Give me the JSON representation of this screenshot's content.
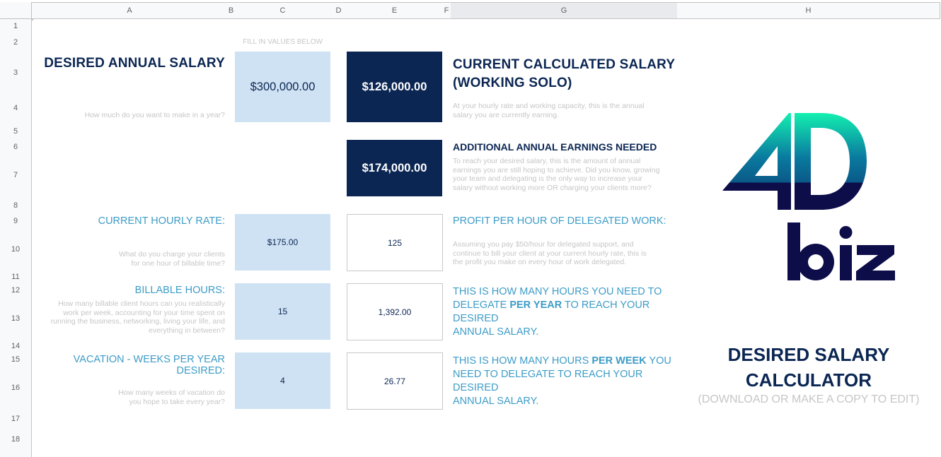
{
  "sheet": {
    "columns": [
      "A",
      "B",
      "C",
      "D",
      "E",
      "F",
      "G",
      "H"
    ],
    "selected_column": "G",
    "rows": [
      "1",
      "2",
      "3",
      "4",
      "5",
      "6",
      "7",
      "8",
      "9",
      "10",
      "11",
      "12",
      "13",
      "14",
      "15",
      "16",
      "17",
      "18"
    ]
  },
  "inputs_header": "FILL IN VALUES BELOW",
  "desired_salary": {
    "label": "DESIRED ANNUAL SALARY",
    "hint": "How much do you want to make in a year?",
    "value": "$300,000.00"
  },
  "current_salary": {
    "value": "$126,000.00",
    "title_line1": "CURRENT CALCULATED SALARY",
    "title_line2": "(WORKING SOLO)",
    "description_line1": "At your hourly rate and working capacity, this is the annual",
    "description_line2": "salary you are currently earning."
  },
  "additional_earnings": {
    "value": "$174,000.00",
    "title": "ADDITIONAL ANNUAL EARNINGS NEEDED",
    "description_lines": [
      "To reach your desired salary, this is the amount of annual",
      "earnings you are still hoping to achieve. Did you know, growing",
      "your team and delegating is the only way to increase your",
      "salary without working more OR charging your clients more?"
    ]
  },
  "hourly_rate": {
    "label": "CURRENT HOURLY RATE:",
    "hint_line1": "What do you charge your clients",
    "hint_line2": "for one hour of billable time?",
    "value": "$175.00"
  },
  "profit_per_hour": {
    "value": "125",
    "title": "PROFIT PER HOUR OF DELEGATED WORK:",
    "description_lines": [
      "Assuming you pay $50/hour for delegated support, and",
      "continue to bill your client at your current hourly rate, this is",
      "the profit you make on every hour of work delegated."
    ]
  },
  "billable_hours": {
    "label": "BILLABLE HOURS:",
    "hint_lines": [
      "How many billable client hours can you realistically",
      "work per week, accounting for your time spent on",
      "running the business, networking, living your life, and",
      "everything in between?"
    ],
    "value": "15"
  },
  "hours_per_year": {
    "value": "1,392.00",
    "line1": "THIS IS HOW MANY HOURS YOU NEED TO",
    "line2_pre": "DELEGATE ",
    "line2_bold": "PER YEAR",
    "line2_post": " TO REACH YOUR DESIRED",
    "line3": "ANNUAL SALARY."
  },
  "vacation": {
    "label": "VACATION - WEEKS PER YEAR DESIRED:",
    "hint_line1": "How many weeks of vacation do",
    "hint_line2": "you hope to take every year?",
    "value": "4"
  },
  "hours_per_week": {
    "value": "26.77",
    "line1_pre": "THIS IS HOW MANY HOURS ",
    "line1_bold": "PER WEEK",
    "line1_post": " YOU",
    "line2": "NEED TO DELEGATE TO REACH YOUR DESIRED",
    "line3": "ANNUAL SALARY."
  },
  "logo": {
    "top_text": "4D",
    "bottom_text": "biz",
    "gradient_top": "#13f0b0",
    "gradient_mid": "#0a6c9c",
    "base_color": "#0d0d4a"
  },
  "calculator_title_line1": "DESIRED SALARY",
  "calculator_title_line2": "CALCULATOR",
  "calculator_subtitle": "(DOWNLOAD OR MAKE A COPY TO EDIT)",
  "colors": {
    "navy": "#0b2653",
    "teal": "#3d9cc7",
    "input_fill": "#cfe2f3",
    "hint_gray": "#c6c6c6"
  }
}
